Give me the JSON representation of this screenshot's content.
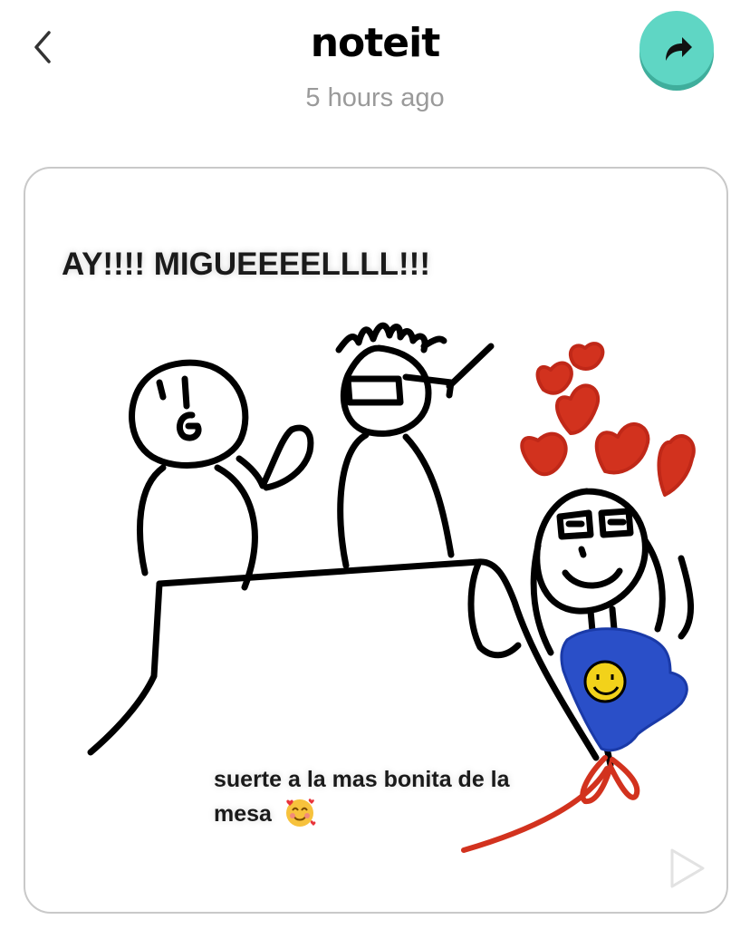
{
  "header": {
    "app_title": "noteit",
    "timestamp": "5 hours ago",
    "back_icon": "chevron-left-icon",
    "share_icon": "share-arrow-icon",
    "share_color": "#5fd6c4"
  },
  "note": {
    "caption_top": "AY!!!! MIGUEEEELLLL!!!",
    "caption_bottom": "suerte a la mas bonita de la mesa",
    "caption_emoji": "smiling-face-with-hearts",
    "play_icon": "play-icon"
  }
}
